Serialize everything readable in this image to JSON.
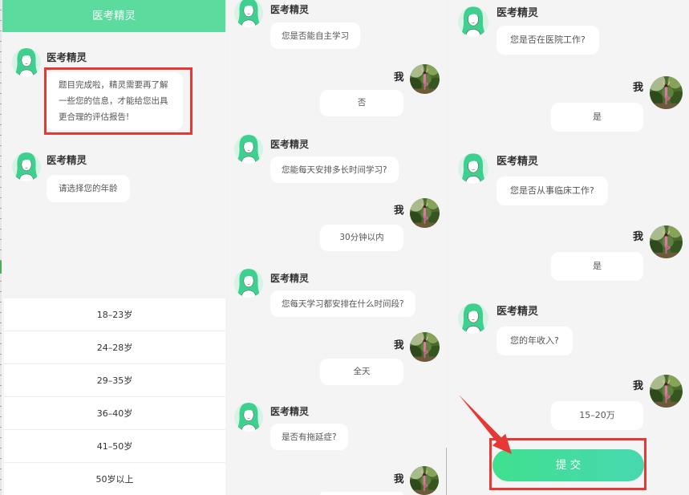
{
  "colors": {
    "header_green": "#5bdc9e",
    "submit_start": "#3fe08f",
    "submit_end": "#48d8b0",
    "annotation_red": "#e53935",
    "bubble_background": "#ffffff",
    "page_background": "#f4f4f4"
  },
  "icons": {
    "bot_avatar": "girl-avatar-icon",
    "user_avatar": "user-photo-avatar",
    "annotation_arrow": "red-arrow-icon"
  },
  "panel1": {
    "header_title": "医考精灵",
    "messages": [
      {
        "sender": "医考精灵",
        "text": "题目完成啦，精灵需要再了解一些您的信息，才能给您出具更合理的评估报告!"
      },
      {
        "sender": "医考精灵",
        "text": "请选择您的年龄"
      }
    ],
    "age_options": [
      "18–23岁",
      "24–28岁",
      "29–35岁",
      "36–40岁",
      "41–50岁",
      "50岁以上"
    ]
  },
  "panel2": {
    "messages": [
      {
        "sender": "医考精灵",
        "text": "您是否能自主学习"
      },
      {
        "sender": "我",
        "text": "否"
      },
      {
        "sender": "医考精灵",
        "text": "您能每天安排多长时间学习?"
      },
      {
        "sender": "我",
        "text": "30分钟以内"
      },
      {
        "sender": "医考精灵",
        "text": "您每天学习都安排在什么时间段?"
      },
      {
        "sender": "我",
        "text": "全天"
      },
      {
        "sender": "医考精灵",
        "text": "是否有拖延症?"
      },
      {
        "sender": "我"
      }
    ]
  },
  "panel3": {
    "messages": [
      {
        "sender": "医考精灵",
        "text": "您是否在医院工作?"
      },
      {
        "sender": "我",
        "text": "是"
      },
      {
        "sender": "医考精灵",
        "text": "您是否从事临床工作?"
      },
      {
        "sender": "我",
        "text": "是"
      },
      {
        "sender": "医考精灵",
        "text": "您的年收入?"
      },
      {
        "sender": "我",
        "text": "15–20万"
      }
    ],
    "submit_label": "提 交"
  }
}
